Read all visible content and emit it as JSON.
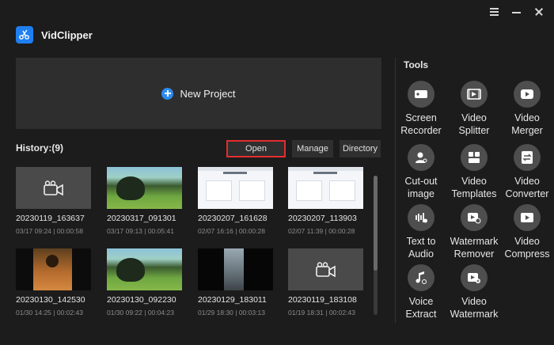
{
  "app": {
    "title": "VidClipper"
  },
  "home": {
    "new_project_label": "New Project"
  },
  "history": {
    "title": "History:(9)",
    "buttons": {
      "open": "Open",
      "manage": "Manage",
      "directory": "Directory"
    },
    "items": [
      {
        "name": "20230119_163637",
        "meta": "03/17 09:24 | 00:00:58",
        "thumb": "blank"
      },
      {
        "name": "20230317_091301",
        "meta": "03/17 09:13 | 00:05:41",
        "thumb": "nature"
      },
      {
        "name": "20230207_161628",
        "meta": "02/07 16:16 | 00:00:28",
        "thumb": "doc"
      },
      {
        "name": "20230207_113903",
        "meta": "02/07 11:39 | 00:00:28",
        "thumb": "doc"
      },
      {
        "name": "20230130_142530",
        "meta": "01/30 14:25 | 00:02:43",
        "thumb": "portrait"
      },
      {
        "name": "20230130_092230",
        "meta": "01/30 09:22 | 00:04:23",
        "thumb": "nature"
      },
      {
        "name": "20230129_183011",
        "meta": "01/29 18:30 | 00:03:13",
        "thumb": "vertical"
      },
      {
        "name": "20230119_183108",
        "meta": "01/19 18:31 | 00:02:43",
        "thumb": "blank"
      }
    ]
  },
  "tools": {
    "title": "Tools",
    "items": [
      {
        "label": "Screen\nRecorder",
        "icon": "screen-recorder-icon"
      },
      {
        "label": "Video\nSplitter",
        "icon": "video-splitter-icon"
      },
      {
        "label": "Video\nMerger",
        "icon": "video-merger-icon"
      },
      {
        "label": "Cut-out\nimage",
        "icon": "cutout-image-icon"
      },
      {
        "label": "Video\nTemplates",
        "icon": "video-templates-icon"
      },
      {
        "label": "Video\nConverter",
        "icon": "video-converter-icon"
      },
      {
        "label": "Text to\nAudio",
        "icon": "text-to-audio-icon"
      },
      {
        "label": "Watermark\nRemover",
        "icon": "watermark-remover-icon"
      },
      {
        "label": "Video\nCompress",
        "icon": "video-compress-icon"
      },
      {
        "label": "Voice\nExtract",
        "icon": "voice-extract-icon"
      },
      {
        "label": "Video\nWatermark",
        "icon": "video-watermark-icon"
      }
    ]
  },
  "colors": {
    "accent": "#2d8cf0",
    "highlight_border": "#e32d2d",
    "background": "#1c1c1c",
    "panel": "#2e2e2e"
  }
}
